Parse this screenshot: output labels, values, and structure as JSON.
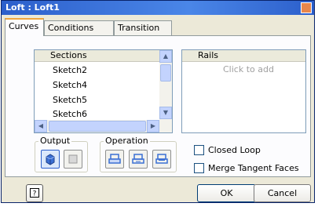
{
  "window": {
    "title": "Loft : Loft1"
  },
  "tabs": [
    {
      "label": "Curves",
      "active": true
    },
    {
      "label": "Conditions",
      "active": false
    },
    {
      "label": "Transition",
      "active": false
    }
  ],
  "sections": {
    "header": "Sections",
    "items": [
      "Sketch2",
      "Sketch4",
      "Sketch5",
      "Sketch6"
    ]
  },
  "rails": {
    "header": "Rails",
    "placeholder": "Click to add"
  },
  "output": {
    "label": "Output",
    "buttons": [
      {
        "icon": "solid-output-icon",
        "selected": true
      },
      {
        "icon": "surface-output-icon",
        "selected": false
      }
    ]
  },
  "operation": {
    "label": "Operation",
    "buttons": [
      {
        "icon": "join-icon"
      },
      {
        "icon": "cut-icon"
      },
      {
        "icon": "intersect-icon"
      }
    ]
  },
  "options": {
    "closed_loop": {
      "label": "Closed Loop",
      "checked": false
    },
    "merge_tangent_faces": {
      "label": "Merge Tangent Faces",
      "checked": false
    }
  },
  "footer": {
    "help_icon": "help-icon",
    "ok_label": "OK",
    "cancel_label": "Cancel"
  },
  "colors": {
    "title_bar": "#2c5fcb",
    "dialog_bg": "#ece9d8",
    "active_tab_accent": "#f1a53d",
    "icon_blue": "#3b6fd4"
  }
}
